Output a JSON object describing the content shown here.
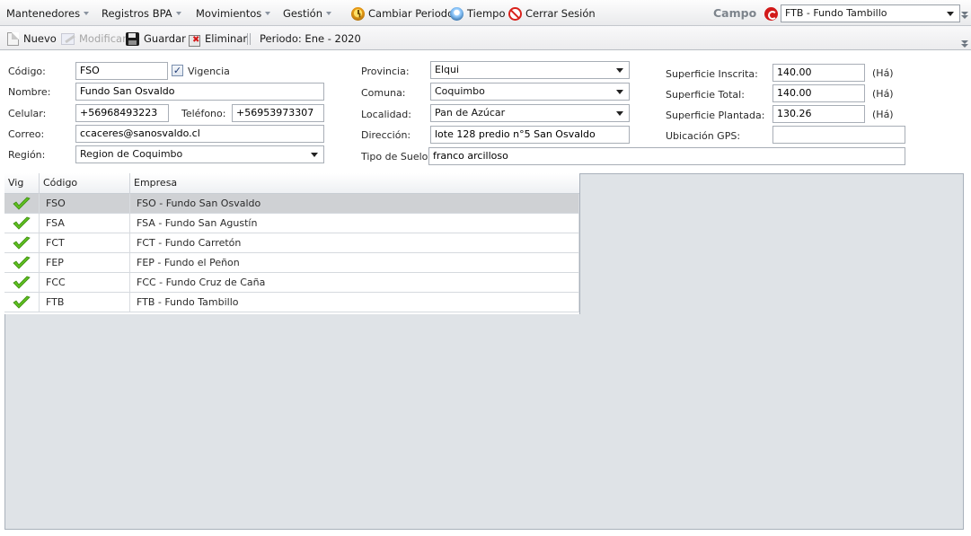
{
  "menu": {
    "items": [
      {
        "label": "Mantenedores",
        "icon": "grid-icon-orange",
        "dropdown": true
      },
      {
        "label": "Registros BPA",
        "icon": "grid-icon-green",
        "dropdown": true
      },
      {
        "label": "Movimientos",
        "icon": "grid-icon-gold",
        "dropdown": true
      },
      {
        "label": "Gestión",
        "icon": "grid-icon-purple",
        "dropdown": true
      },
      {
        "label": "Cambiar Periodo",
        "icon": "clock-icon",
        "dropdown": false
      },
      {
        "label": "Tiempo",
        "icon": "weather-icon",
        "dropdown": false
      },
      {
        "label": "Cerrar Sesión",
        "icon": "no-entry-icon",
        "dropdown": false
      }
    ],
    "campo_label": "Campo",
    "campo_value": "FTB - Fundo Tambillo"
  },
  "toolbar": {
    "nuevo": "Nuevo",
    "modificar": "Modificar",
    "guardar": "Guardar",
    "eliminar": "Eliminar",
    "periodo": "Periodo: Ene - 2020"
  },
  "form": {
    "codigo_label": "Código:",
    "codigo": "FSO",
    "vigencia_label": "Vigencia",
    "vigencia_checked": true,
    "nombre_label": "Nombre:",
    "nombre": "Fundo San Osvaldo",
    "celular_label": "Celular:",
    "celular": "+56968493223",
    "telefono_label": "Teléfono:",
    "telefono": "+56953973307",
    "correo_label": "Correo:",
    "correo": "ccaceres@sanosvaldo.cl",
    "region_label": "Región:",
    "region": "Region de Coquimbo",
    "provincia_label": "Provincia:",
    "provincia": "Elqui",
    "comuna_label": "Comuna:",
    "comuna": "Coquimbo",
    "localidad_label": "Localidad:",
    "localidad": "Pan de Azúcar",
    "direccion_label": "Dirección:",
    "direccion": "lote 128 predio n°5 San Osvaldo",
    "tipo_suelo_label": "Tipo de Suelo:",
    "tipo_suelo": "franco arcilloso",
    "sup_inscrita_label": "Superficie Inscrita:",
    "sup_inscrita": "140.00",
    "sup_total_label": "Superficie Total:",
    "sup_total": "140.00",
    "sup_plantada_label": "Superficie Plantada:",
    "sup_plantada": "130.26",
    "unit": "(Há)",
    "gps_label": "Ubicación GPS:",
    "gps": ""
  },
  "grid": {
    "headers": {
      "vig": "Vig",
      "codigo": "Código",
      "empresa": "Empresa"
    },
    "rows": [
      {
        "vig": true,
        "codigo": "FSO",
        "empresa": "FSO - Fundo San Osvaldo"
      },
      {
        "vig": true,
        "codigo": "FSA",
        "empresa": "FSA - Fundo San Agustín"
      },
      {
        "vig": true,
        "codigo": "FCT",
        "empresa": "FCT - Fundo Carretón"
      },
      {
        "vig": true,
        "codigo": "FEP",
        "empresa": "FEP - Fundo el Peñon"
      },
      {
        "vig": true,
        "codigo": "FCC",
        "empresa": "FCC - Fundo Cruz de Caña"
      },
      {
        "vig": true,
        "codigo": "FTB",
        "empresa": "FTB - Fundo Tambillo"
      }
    ]
  },
  "colors": {
    "accent_red": "#d21919",
    "check_green": "#5fbf1f",
    "selected_row": "#cfd1d4",
    "panel_bg": "#dfe3e7"
  }
}
